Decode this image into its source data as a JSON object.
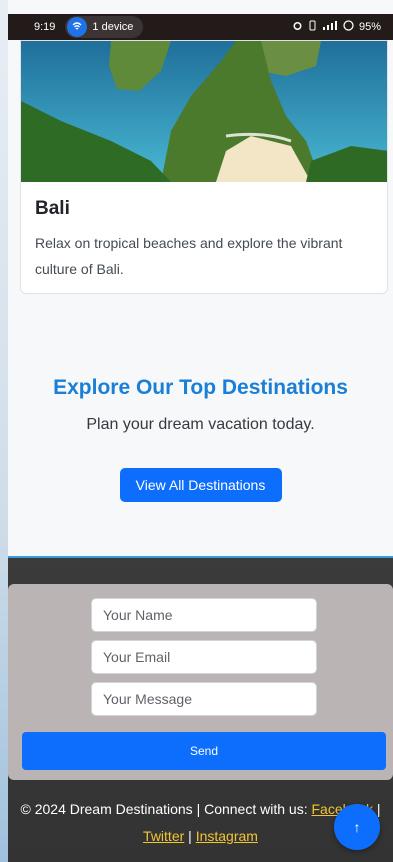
{
  "status_bar": {
    "time": "9:19",
    "cast_label": "1 device",
    "alarm_icon": "alarm-icon",
    "signal_text": "ᵞᵢₗ",
    "battery": "95%"
  },
  "card": {
    "image_icon": "bali-photo",
    "title": "Bali",
    "text": "Relax on tropical beaches and explore the vibrant culture of Bali."
  },
  "cta": {
    "title": "Explore Our Top Destinations",
    "subtitle": "Plan your dream vacation today.",
    "button": "View All Destinations"
  },
  "form": {
    "name_placeholder": "Your Name",
    "email_placeholder": "Your Email",
    "message_placeholder": "Your Message",
    "send": "Send"
  },
  "footer": {
    "copyright": "© 2024 Dream Destinations | Connect with us:",
    "facebook": "Facebook",
    "sep1": "|",
    "twitter": "Twitter",
    "sep2": "|",
    "instagram": "Instagram"
  },
  "fab": {
    "label": "↑"
  },
  "colors": {
    "accent": "#0d6efd",
    "heading": "#1a7fd6",
    "link": "#f3c531",
    "footer_bg": "#333333"
  }
}
